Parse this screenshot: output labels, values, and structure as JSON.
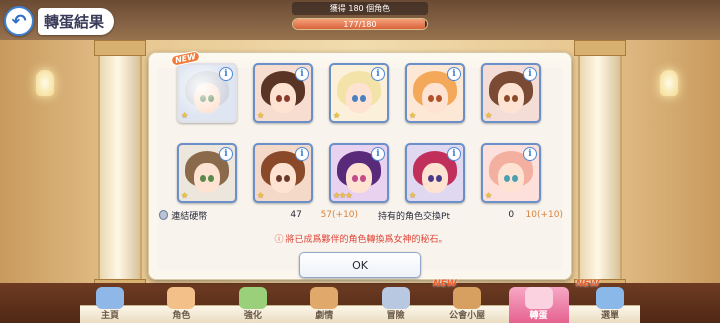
{
  "header": {
    "back_icon": "back-arrow-icon",
    "title": "轉蛋結果"
  },
  "progress": {
    "text": "獲得 180 個角色",
    "count": "177/180",
    "current": 177,
    "total": 180
  },
  "cards": [
    {
      "name": "card-1",
      "is_new": true,
      "new_label": "NEW",
      "stars": 1,
      "hair": "#cfd3dc",
      "eye": "#5a8a5a",
      "bg": "#dfe6f2"
    },
    {
      "name": "card-2",
      "is_new": false,
      "stars": 1,
      "hair": "#5a3424",
      "eye": "#8a3a2a",
      "bg": "#f6ddd0"
    },
    {
      "name": "card-3",
      "is_new": false,
      "stars": 1,
      "hair": "#f3e3a8",
      "eye": "#4a7fc0",
      "bg": "#fbf1da"
    },
    {
      "name": "card-4",
      "is_new": false,
      "stars": 1,
      "hair": "#f3a85a",
      "eye": "#b0522a",
      "bg": "#fce8d4"
    },
    {
      "name": "card-5",
      "is_new": false,
      "stars": 1,
      "hair": "#7a4a34",
      "eye": "#8a4a2a",
      "bg": "#f3ddd6"
    },
    {
      "name": "card-6",
      "is_new": false,
      "stars": 1,
      "hair": "#8a6a4a",
      "eye": "#5a8a4a",
      "bg": "#ece6dc"
    },
    {
      "name": "card-7",
      "is_new": false,
      "stars": 1,
      "hair": "#8a4a2a",
      "eye": "#6a3a2a",
      "bg": "#f4d8c8"
    },
    {
      "name": "card-8",
      "is_new": false,
      "stars": 3,
      "hair": "#5a2a7a",
      "eye": "#c04a8a",
      "bg": "#e8d2f0"
    },
    {
      "name": "card-9",
      "is_new": false,
      "stars": 1,
      "hair": "#c0305a",
      "eye": "#4a3a8a",
      "bg": "#e0d8f0"
    },
    {
      "name": "card-10",
      "is_new": false,
      "stars": 1,
      "hair": "#f3b0a0",
      "eye": "#4aa0b0",
      "bg": "#fde0dc"
    }
  ],
  "stats": {
    "coin_icon": "coin-icon",
    "coin_label": "連結硬幣",
    "coin_value": "47",
    "coin_after": "57(+10)",
    "pt_label": "持有的角色交換Pt",
    "pt_value": "0",
    "pt_after": "10(+10)"
  },
  "note": {
    "icon": "info-circle-icon",
    "text": "將已成爲夥伴的角色轉換爲女神的秘石。"
  },
  "ok_label": "OK",
  "nav": {
    "items": [
      {
        "label": "主頁",
        "new": "",
        "active": false,
        "color": "#8fb8e8"
      },
      {
        "label": "角色",
        "new": "",
        "active": false,
        "color": "#f3c08a"
      },
      {
        "label": "強化",
        "new": "",
        "active": false,
        "color": "#9ad07a"
      },
      {
        "label": "劇情",
        "new": "",
        "active": false,
        "color": "#e0a86a"
      },
      {
        "label": "冒險",
        "new": "",
        "active": false,
        "color": "#b8c8e0"
      },
      {
        "label": "公會小屋",
        "new": "NEW",
        "active": false,
        "color": "#d8a060"
      },
      {
        "label": "轉蛋",
        "new": "",
        "active": true,
        "color": "#fbd2e0"
      },
      {
        "label": "選單",
        "new": "NEW",
        "active": false,
        "color": "#8ab8e8"
      }
    ]
  }
}
